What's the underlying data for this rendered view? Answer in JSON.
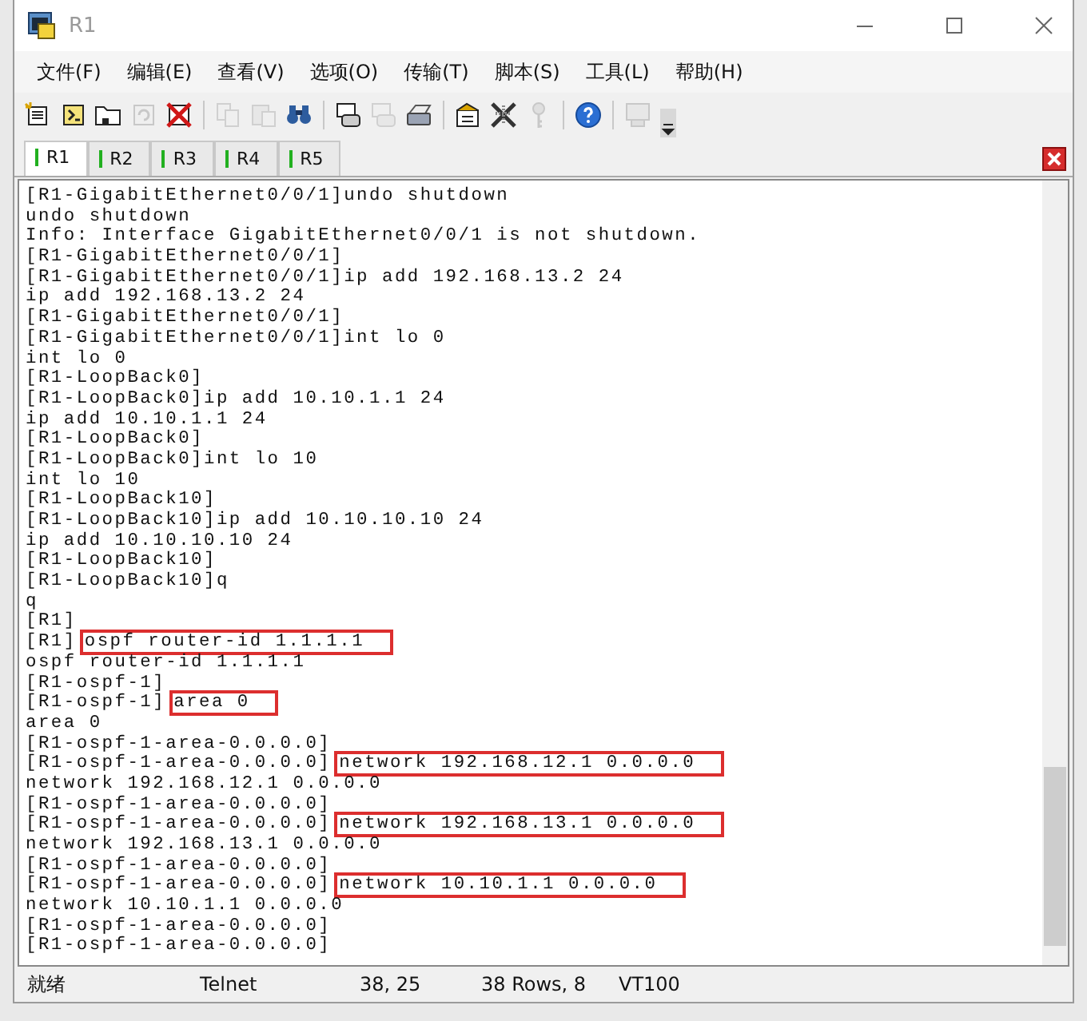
{
  "window": {
    "title": "R1"
  },
  "menu": [
    {
      "label": "文件(F)"
    },
    {
      "label": "编辑(E)"
    },
    {
      "label": "查看(V)"
    },
    {
      "label": "选项(O)"
    },
    {
      "label": "传输(T)"
    },
    {
      "label": "脚本(S)"
    },
    {
      "label": "工具(L)"
    },
    {
      "label": "帮助(H)"
    }
  ],
  "toolbar": [
    {
      "kind": "new",
      "disabled": false
    },
    {
      "kind": "quick",
      "disabled": false
    },
    {
      "kind": "tab",
      "disabled": false
    },
    {
      "kind": "reconnect",
      "disabled": true
    },
    {
      "kind": "disconnect",
      "disabled": false
    },
    {
      "kind": "sep"
    },
    {
      "kind": "copy",
      "disabled": true
    },
    {
      "kind": "paste",
      "disabled": true
    },
    {
      "kind": "find",
      "disabled": false
    },
    {
      "kind": "sep"
    },
    {
      "kind": "printsetup",
      "disabled": false
    },
    {
      "kind": "printselect",
      "disabled": true
    },
    {
      "kind": "print",
      "disabled": false
    },
    {
      "kind": "sep"
    },
    {
      "kind": "options",
      "disabled": false
    },
    {
      "kind": "tools",
      "disabled": false
    },
    {
      "kind": "key",
      "disabled": true
    },
    {
      "kind": "sep"
    },
    {
      "kind": "help",
      "disabled": false
    },
    {
      "kind": "sep"
    },
    {
      "kind": "monitor",
      "disabled": true
    },
    {
      "kind": "more",
      "disabled": false
    }
  ],
  "tabs": [
    {
      "label": "R1",
      "selected": true,
      "connected": true
    },
    {
      "label": "R2",
      "selected": false,
      "connected": true
    },
    {
      "label": "R3",
      "selected": false,
      "connected": true
    },
    {
      "label": "R4",
      "selected": false,
      "connected": true
    },
    {
      "label": "R5",
      "selected": false,
      "connected": true
    }
  ],
  "terminal": {
    "lines": [
      {
        "text": "[R1-GigabitEthernet0/0/1]undo shutdown",
        "highlighted": false
      },
      {
        "text": "undo shutdown",
        "highlighted": false
      },
      {
        "text": "Info: Interface GigabitEthernet0/0/1 is not shutdown.",
        "highlighted": false
      },
      {
        "text": "[R1-GigabitEthernet0/0/1]",
        "highlighted": false
      },
      {
        "text": "[R1-GigabitEthernet0/0/1]ip add 192.168.13.2 24",
        "highlighted": false
      },
      {
        "text": "ip add 192.168.13.2 24",
        "highlighted": false
      },
      {
        "text": "[R1-GigabitEthernet0/0/1]",
        "highlighted": false
      },
      {
        "text": "[R1-GigabitEthernet0/0/1]int lo 0",
        "highlighted": false
      },
      {
        "text": "int lo 0",
        "highlighted": false
      },
      {
        "text": "[R1-LoopBack0]",
        "highlighted": false
      },
      {
        "text": "[R1-LoopBack0]ip add 10.10.1.1 24",
        "highlighted": false
      },
      {
        "text": "ip add 10.10.1.1 24",
        "highlighted": false
      },
      {
        "text": "[R1-LoopBack0]",
        "highlighted": false
      },
      {
        "text": "[R1-LoopBack0]int lo 10",
        "highlighted": false
      },
      {
        "text": "int lo 10",
        "highlighted": false
      },
      {
        "text": "[R1-LoopBack10]",
        "highlighted": false
      },
      {
        "text": "[R1-LoopBack10]ip add 10.10.10.10 24",
        "highlighted": false
      },
      {
        "text": "ip add 10.10.10.10 24",
        "highlighted": false
      },
      {
        "text": "[R1-LoopBack10]",
        "highlighted": false
      },
      {
        "text": "[R1-LoopBack10]q",
        "highlighted": false
      },
      {
        "text": "q",
        "highlighted": false
      },
      {
        "text": "[R1]",
        "highlighted": false
      },
      {
        "prompt": "[R1]",
        "command": "ospf router-id 1.1.1.1",
        "highlighted": true
      },
      {
        "text": "ospf router-id 1.1.1.1",
        "highlighted": false
      },
      {
        "text": "[R1-ospf-1]",
        "highlighted": false
      },
      {
        "prompt": "[R1-ospf-1]",
        "command": "area 0",
        "highlighted": true
      },
      {
        "text": "area 0",
        "highlighted": false
      },
      {
        "text": "[R1-ospf-1-area-0.0.0.0]",
        "highlighted": false
      },
      {
        "prompt": "[R1-ospf-1-area-0.0.0.0]",
        "command": "network 192.168.12.1 0.0.0.0",
        "highlighted": true
      },
      {
        "text": "network 192.168.12.1 0.0.0.0",
        "highlighted": false
      },
      {
        "text": "[R1-ospf-1-area-0.0.0.0]",
        "highlighted": false
      },
      {
        "prompt": "[R1-ospf-1-area-0.0.0.0]",
        "command": "network 192.168.13.1 0.0.0.0",
        "highlighted": true
      },
      {
        "text": "network 192.168.13.1 0.0.0.0",
        "highlighted": false
      },
      {
        "text": "[R1-ospf-1-area-0.0.0.0]",
        "highlighted": false
      },
      {
        "prompt": "[R1-ospf-1-area-0.0.0.0]",
        "command": "network 10.10.1.1 0.0.0.0",
        "highlighted": true
      },
      {
        "text": "network 10.10.1.1 0.0.0.0",
        "highlighted": false
      },
      {
        "text": "[R1-ospf-1-area-0.0.0.0]",
        "highlighted": false
      },
      {
        "text": "[R1-ospf-1-area-0.0.0.0]",
        "highlighted": false
      }
    ]
  },
  "status_bar": [
    {
      "text": "就绪"
    },
    {
      "text": "Telnet"
    },
    {
      "text": "38,  25"
    },
    {
      "text": "38 Rows,  8"
    },
    {
      "text": "VT100"
    }
  ]
}
